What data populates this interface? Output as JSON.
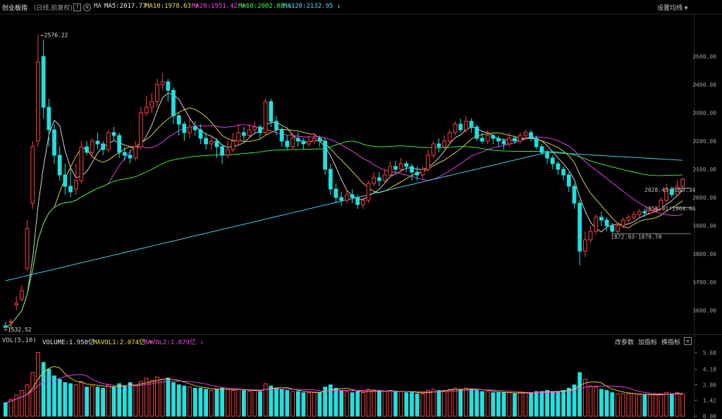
{
  "header": {
    "title": "创业板指",
    "subtitle": "(日线,前复权)",
    "ma_label": "MA",
    "ma_values": [
      {
        "label": "MA5:2017.77",
        "color": "#e8e8e8",
        "arrow": ""
      },
      {
        "label": "MA10:1978.63",
        "color": "#f0e040",
        "arrow": "↑"
      },
      {
        "label": "MA20:1951.42",
        "color": "#ff40ff",
        "arrow": "↑"
      },
      {
        "label": "MA60:2002.88",
        "color": "#40ff40",
        "arrow": "↓"
      },
      {
        "label": "MA120:2132.95",
        "color": "#40e0ff",
        "arrow": "↓"
      }
    ],
    "settings_label": "设置均线"
  },
  "volume_header": {
    "label": "VOL(5,10)",
    "items": [
      {
        "label": "VOLUME:1.950亿",
        "color": "#e8e8e8",
        "arrow": ""
      },
      {
        "label": "MAVOL1:2.074亿",
        "color": "#f0e040",
        "arrow": "↑"
      },
      {
        "label": "MAVOL2:1.879亿",
        "color": "#ff40ff",
        "arrow": "↓"
      }
    ],
    "buttons": [
      "改参数",
      "加指标",
      "换指标"
    ]
  },
  "colors": {
    "up": "#ff4040",
    "down": "#20e0e0",
    "ma5": "#e8e8e8",
    "ma10": "#f0e040",
    "ma20": "#ff40ff",
    "ma60": "#40ff40",
    "ma120": "#40e0ff"
  },
  "chart_data": {
    "type": "candlestick",
    "price_axis": {
      "min": 1520,
      "max": 2650,
      "ticks": [
        "2500.00",
        "2400.00",
        "2300.00",
        "2200.00",
        "2100.00",
        "2000.00",
        "1900.00",
        "1800.00",
        "1700.00",
        "1600.00"
      ]
    },
    "volume_axis": {
      "min": 0,
      "max": 6.3,
      "ticks": [
        "5.68",
        "4.18",
        "2.80",
        "1.42",
        "0.00"
      ]
    },
    "annotations": {
      "high": "2576.22",
      "low": "1532.52",
      "mid_low": "1872.93-1879.78",
      "mid_right": "1954.91-1964.46",
      "right": "2028.43-2053.34"
    },
    "candles": [
      [
        1545,
        1540,
        1560,
        1535,
        1.2
      ],
      [
        1560,
        1560,
        1570,
        1532,
        1.5
      ],
      [
        1620,
        1625,
        1650,
        1600,
        1.9
      ],
      [
        1640,
        1670,
        1690,
        1630,
        2.3
      ],
      [
        1750,
        1890,
        1920,
        1740,
        2.8
      ],
      [
        1980,
        2180,
        2200,
        1960,
        3.9
      ],
      [
        2200,
        2480,
        2576,
        2180,
        5.7
      ],
      [
        2500,
        2320,
        2560,
        2280,
        4.8
      ],
      [
        2320,
        2240,
        2350,
        2180,
        4.2
      ],
      [
        2240,
        2150,
        2260,
        2120,
        3.6
      ],
      [
        2150,
        2080,
        2180,
        2060,
        3.3
      ],
      [
        2080,
        2040,
        2120,
        2010,
        3.0
      ],
      [
        2040,
        2020,
        2100,
        2000,
        2.9
      ],
      [
        2030,
        2060,
        2120,
        2010,
        2.8
      ],
      [
        2060,
        2180,
        2200,
        2050,
        3.1
      ],
      [
        2180,
        2160,
        2200,
        2150,
        2.6
      ],
      [
        2160,
        2200,
        2210,
        2140,
        2.7
      ],
      [
        2200,
        2190,
        2230,
        2170,
        2.6
      ],
      [
        2190,
        2170,
        2200,
        2150,
        2.5
      ],
      [
        2170,
        2230,
        2240,
        2160,
        2.8
      ],
      [
        2230,
        2220,
        2250,
        2200,
        2.6
      ],
      [
        2220,
        2160,
        2230,
        2140,
        2.9
      ],
      [
        2160,
        2150,
        2180,
        2130,
        2.7
      ],
      [
        2150,
        2140,
        2170,
        2120,
        3.0
      ],
      [
        2140,
        2180,
        2200,
        2130,
        2.7
      ],
      [
        2180,
        2300,
        2320,
        2170,
        3.1
      ],
      [
        2300,
        2320,
        2360,
        2290,
        3.4
      ],
      [
        2320,
        2340,
        2370,
        2300,
        3.2
      ],
      [
        2340,
        2400,
        2420,
        2320,
        3.5
      ],
      [
        2400,
        2410,
        2440,
        2380,
        3.3
      ],
      [
        2410,
        2380,
        2420,
        2340,
        3.4
      ],
      [
        2380,
        2290,
        2390,
        2260,
        3.0
      ],
      [
        2290,
        2260,
        2300,
        2220,
        2.8
      ],
      [
        2260,
        2230,
        2270,
        2200,
        2.7
      ],
      [
        2230,
        2250,
        2280,
        2210,
        2.6
      ],
      [
        2250,
        2240,
        2270,
        2220,
        2.5
      ],
      [
        2240,
        2210,
        2260,
        2190,
        2.5
      ],
      [
        2210,
        2190,
        2230,
        2170,
        2.4
      ],
      [
        2190,
        2200,
        2220,
        2170,
        2.3
      ],
      [
        2200,
        2180,
        2210,
        2140,
        2.4
      ],
      [
        2180,
        2150,
        2190,
        2120,
        2.5
      ],
      [
        2150,
        2170,
        2200,
        2140,
        2.4
      ],
      [
        2170,
        2200,
        2230,
        2160,
        2.3
      ],
      [
        2200,
        2230,
        2260,
        2190,
        2.4
      ],
      [
        2230,
        2220,
        2250,
        2200,
        2.3
      ],
      [
        2220,
        2240,
        2260,
        2210,
        2.2
      ],
      [
        2240,
        2250,
        2270,
        2230,
        2.3
      ],
      [
        2250,
        2230,
        2260,
        2210,
        2.2
      ],
      [
        2230,
        2340,
        2350,
        2220,
        2.9
      ],
      [
        2340,
        2270,
        2350,
        2250,
        2.7
      ],
      [
        2270,
        2240,
        2290,
        2220,
        2.5
      ],
      [
        2240,
        2200,
        2250,
        2180,
        2.4
      ],
      [
        2200,
        2180,
        2220,
        2170,
        2.3
      ],
      [
        2180,
        2210,
        2230,
        2170,
        2.2
      ],
      [
        2210,
        2200,
        2230,
        2180,
        2.2
      ],
      [
        2200,
        2190,
        2210,
        2170,
        2.1
      ],
      [
        2190,
        2200,
        2220,
        2180,
        2.1
      ],
      [
        2200,
        2210,
        2230,
        2190,
        2.1
      ],
      [
        2210,
        2200,
        2220,
        2180,
        2.1
      ],
      [
        2200,
        2100,
        2210,
        2080,
        2.6
      ],
      [
        2100,
        2030,
        2120,
        2010,
        2.8
      ],
      [
        2030,
        2000,
        2050,
        1980,
        2.5
      ],
      [
        2000,
        1990,
        2020,
        1970,
        2.3
      ],
      [
        1990,
        2010,
        2030,
        1980,
        2.2
      ],
      [
        2010,
        2000,
        2030,
        1980,
        2.1
      ],
      [
        2000,
        1975,
        2010,
        1960,
        2.2
      ],
      [
        1975,
        1990,
        2000,
        1960,
        2.1
      ],
      [
        1990,
        2050,
        2060,
        1980,
        2.4
      ],
      [
        2050,
        2070,
        2090,
        2040,
        2.3
      ],
      [
        2070,
        2060,
        2090,
        2040,
        2.2
      ],
      [
        2060,
        2080,
        2100,
        2050,
        2.2
      ],
      [
        2080,
        2110,
        2130,
        2070,
        2.3
      ],
      [
        2110,
        2100,
        2130,
        2090,
        2.2
      ],
      [
        2100,
        2120,
        2140,
        2090,
        2.2
      ],
      [
        2120,
        2110,
        2130,
        2090,
        2.1
      ],
      [
        2110,
        2090,
        2120,
        2060,
        2.1
      ],
      [
        2090,
        2080,
        2110,
        2060,
        2.0
      ],
      [
        2080,
        2100,
        2110,
        2070,
        2.0
      ],
      [
        2100,
        2150,
        2170,
        2090,
        2.3
      ],
      [
        2150,
        2190,
        2200,
        2140,
        2.4
      ],
      [
        2190,
        2180,
        2210,
        2160,
        2.3
      ],
      [
        2180,
        2200,
        2220,
        2170,
        2.3
      ],
      [
        2200,
        2230,
        2240,
        2190,
        2.4
      ],
      [
        2230,
        2260,
        2270,
        2220,
        2.5
      ],
      [
        2260,
        2240,
        2280,
        2230,
        2.4
      ],
      [
        2240,
        2270,
        2290,
        2230,
        2.5
      ],
      [
        2270,
        2250,
        2280,
        2230,
        2.4
      ],
      [
        2250,
        2210,
        2260,
        2200,
        2.3
      ],
      [
        2210,
        2200,
        2230,
        2190,
        2.2
      ],
      [
        2200,
        2220,
        2240,
        2190,
        2.2
      ],
      [
        2220,
        2210,
        2230,
        2190,
        2.1
      ],
      [
        2210,
        2200,
        2220,
        2180,
        2.1
      ],
      [
        2200,
        2190,
        2210,
        2170,
        2.1
      ],
      [
        2190,
        2210,
        2230,
        2180,
        2.1
      ],
      [
        2210,
        2200,
        2220,
        2190,
        2.0
      ],
      [
        2200,
        2220,
        2230,
        2190,
        2.1
      ],
      [
        2220,
        2230,
        2240,
        2210,
        2.1
      ],
      [
        2230,
        2210,
        2240,
        2200,
        2.1
      ],
      [
        2210,
        2180,
        2220,
        2170,
        2.2
      ],
      [
        2180,
        2160,
        2190,
        2150,
        2.2
      ],
      [
        2160,
        2140,
        2170,
        2120,
        2.3
      ],
      [
        2140,
        2120,
        2150,
        2100,
        2.2
      ],
      [
        2120,
        2100,
        2130,
        2080,
        2.2
      ],
      [
        2100,
        2080,
        2110,
        2060,
        2.3
      ],
      [
        2080,
        2040,
        2090,
        2020,
        2.5
      ],
      [
        2040,
        1980,
        2050,
        1960,
        2.8
      ],
      [
        1980,
        1810,
        1990,
        1760,
        3.9
      ],
      [
        1810,
        1850,
        1880,
        1790,
        3.3
      ],
      [
        1850,
        1880,
        1900,
        1840,
        2.7
      ],
      [
        1880,
        1930,
        1940,
        1870,
        2.6
      ],
      [
        1930,
        1920,
        1950,
        1900,
        2.4
      ],
      [
        1920,
        1900,
        1930,
        1880,
        2.3
      ],
      [
        1900,
        1880,
        1910,
        1872,
        2.1
      ],
      [
        1880,
        1900,
        1910,
        1870,
        2.0
      ],
      [
        1900,
        1920,
        1930,
        1890,
        2.0
      ],
      [
        1920,
        1930,
        1940,
        1910,
        2.0
      ],
      [
        1930,
        1940,
        1950,
        1920,
        2.0
      ],
      [
        1940,
        1950,
        1960,
        1930,
        1.9
      ],
      [
        1950,
        1945,
        1960,
        1930,
        1.9
      ],
      [
        1945,
        1955,
        1964,
        1940,
        1.9
      ],
      [
        1955,
        1960,
        1970,
        1950,
        1.9
      ],
      [
        1960,
        1990,
        2000,
        1955,
        2.0
      ],
      [
        1990,
        2030,
        2050,
        1985,
        2.1
      ],
      [
        2030,
        2010,
        2040,
        2000,
        2.0
      ],
      [
        2010,
        2040,
        2060,
        2005,
        2.1
      ],
      [
        2040,
        2065,
        2070,
        2030,
        1.95
      ]
    ]
  }
}
